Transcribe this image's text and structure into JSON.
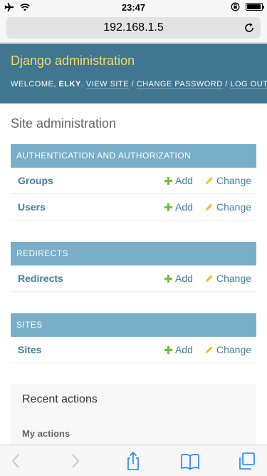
{
  "status_bar": {
    "time": "23:47",
    "icons": [
      "airplane-icon",
      "wifi-icon",
      "rotation-lock-icon",
      "battery-icon"
    ],
    "battery_level": 0.95
  },
  "browser": {
    "address": "192.168.1.5",
    "toolbar_icons": [
      "back-icon",
      "forward-icon",
      "share-icon",
      "bookmarks-icon",
      "tabs-icon"
    ]
  },
  "header": {
    "branding": "Django administration",
    "welcome_prefix": "WELCOME, ",
    "username": "ELKY",
    "links": {
      "view_site": "VIEW SITE",
      "change_password": "CHANGE PASSWORD",
      "logout": "LOG OUT"
    },
    "separator": " / "
  },
  "content": {
    "title": "Site administration",
    "modules": [
      {
        "caption": "AUTHENTICATION AND AUTHORIZATION",
        "models": [
          {
            "name": "Groups",
            "add": "Add",
            "change": "Change"
          },
          {
            "name": "Users",
            "add": "Add",
            "change": "Change"
          }
        ]
      },
      {
        "caption": "REDIRECTS",
        "models": [
          {
            "name": "Redirects",
            "add": "Add",
            "change": "Change"
          }
        ]
      },
      {
        "caption": "SITES",
        "models": [
          {
            "name": "Sites",
            "add": "Add",
            "change": "Change"
          }
        ]
      }
    ]
  },
  "recent_actions": {
    "title": "Recent actions",
    "subtitle": "My actions"
  },
  "colors": {
    "header_bg": "#417690",
    "branding": "#f5dd5d",
    "caption_bg": "#79aec8",
    "link": "#447e9b",
    "add_icon": "#70bf2b",
    "change_icon": "#efb80b",
    "ios_blue": "#1a82fb"
  }
}
